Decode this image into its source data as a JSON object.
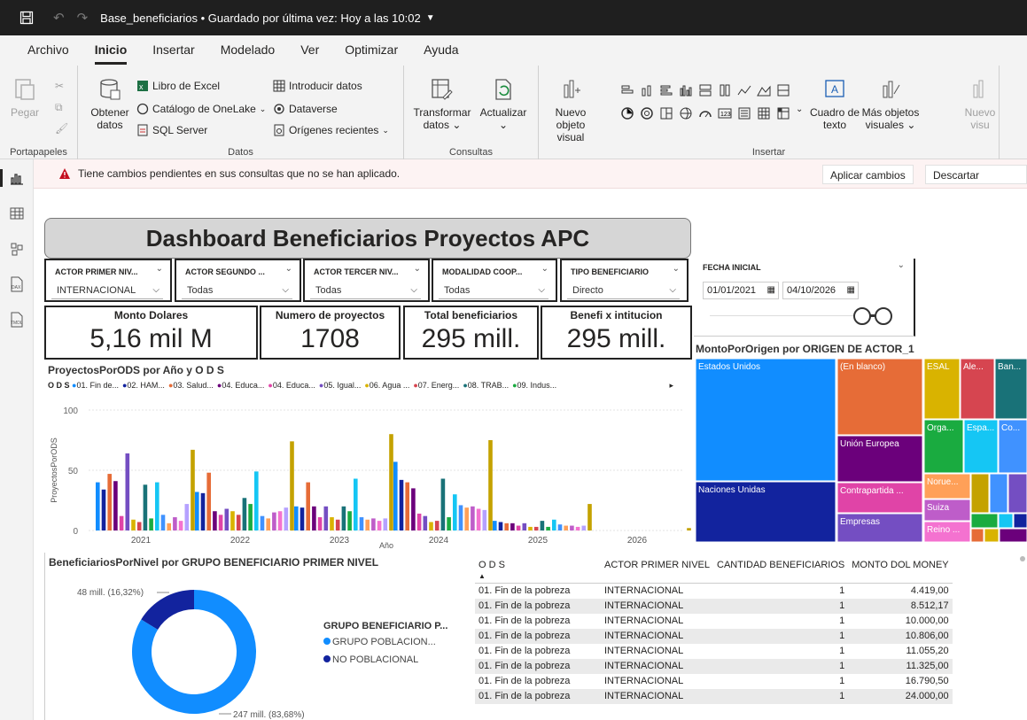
{
  "titlebar": {
    "title": "Base_beneficiarios • Guardado por última vez: Hoy a las 10:02"
  },
  "tabs": [
    "Archivo",
    "Inicio",
    "Insertar",
    "Modelado",
    "Ver",
    "Optimizar",
    "Ayuda"
  ],
  "ribbon": {
    "portapapeles": {
      "paste": "Pegar",
      "label": "Portapapeles"
    },
    "datos": {
      "get_data": "Obtener datos",
      "excel": "Libro de Excel",
      "onelake": "Catálogo de OneLake",
      "sql": "SQL Server",
      "enter_data": "Introducir datos",
      "dataverse": "Dataverse",
      "recent": "Orígenes recientes",
      "label": "Datos"
    },
    "consultas": {
      "transform": "Transformar datos",
      "refresh": "Actualizar",
      "label": "Consultas"
    },
    "insertar": {
      "new_visual": "Nuevo objeto visual",
      "text_box": "Cuadro de texto",
      "more_visuals": "Más objetos visuales",
      "new_visual_2": "Nuevo visu",
      "label": "Insertar"
    }
  },
  "warning": {
    "text": "Tiene cambios pendientes en sus consultas que no se han aplicado.",
    "apply": "Aplicar cambios",
    "discard": "Descartar cambios"
  },
  "dashboard": {
    "title": "Dashboard Beneficiarios Proyectos APC",
    "slicers": [
      {
        "header": "ACTOR PRIMER NIV...",
        "value": "INTERNACIONAL"
      },
      {
        "header": "ACTOR SEGUNDO ...",
        "value": "Todas"
      },
      {
        "header": "ACTOR TERCER NIV...",
        "value": "Todas"
      },
      {
        "header": "MODALIDAD COOP...",
        "value": "Todas"
      },
      {
        "header": "TIPO BENEFICIARIO",
        "value": "Directo"
      }
    ],
    "date_slicer": {
      "header": "FECHA INICIAL",
      "from": "01/01/2021",
      "to": "04/10/2026"
    },
    "kpis": [
      {
        "label": "Monto Dolares",
        "value": "5,16 mil M"
      },
      {
        "label": "Numero de proyectos",
        "value": "1708"
      },
      {
        "label": "Total beneficiarios",
        "value": "295 mill."
      },
      {
        "label": "Benefi x intitucion",
        "value": "295 mill."
      }
    ],
    "bar_chart_title": "ProyectosPorODS por Año y O D S",
    "treemap_title": "MontoPorOrigen por ORIGEN DE ACTOR_1",
    "donut_title": "BeneficiariosPorNivel por GRUPO BENEFICIARIO PRIMER NIVEL",
    "donut_legend_title": "GRUPO BENEFICIARIO P...",
    "donut_labels": [
      "48 mill. (16,32%)",
      "247 mill. (83,68%)"
    ],
    "table": {
      "headers": [
        "O D S",
        "ACTOR PRIMER NIVEL",
        "CANTIDAD BENEFICIARIOS",
        "MONTO DOL MONEY"
      ],
      "rows": [
        [
          "01. Fin de la pobreza",
          "INTERNACIONAL",
          "1",
          "4.419,00"
        ],
        [
          "01. Fin de la pobreza",
          "INTERNACIONAL",
          "1",
          "8.512,17"
        ],
        [
          "01. Fin de la pobreza",
          "INTERNACIONAL",
          "1",
          "10.000,00"
        ],
        [
          "01. Fin de la pobreza",
          "INTERNACIONAL",
          "1",
          "10.806,00"
        ],
        [
          "01. Fin de la pobreza",
          "INTERNACIONAL",
          "1",
          "11.055,20"
        ],
        [
          "01. Fin de la pobreza",
          "INTERNACIONAL",
          "1",
          "11.325,00"
        ],
        [
          "01. Fin de la pobreza",
          "INTERNACIONAL",
          "1",
          "16.790,50"
        ],
        [
          "01. Fin de la pobreza",
          "INTERNACIONAL",
          "1",
          "24.000,00"
        ]
      ]
    }
  },
  "chart_data": [
    {
      "type": "bar",
      "title": "ProyectosPorODS por Año y O D S",
      "xlabel": "Año",
      "ylabel": "ProyectosPorODS",
      "ylim": [
        0,
        100
      ],
      "yticks": [
        0,
        50,
        100
      ],
      "legend_title": "O D S",
      "legend_placement": "top",
      "categories": [
        "2021",
        "2022",
        "2023",
        "2024",
        "2025",
        "2026"
      ],
      "series": [
        {
          "name": "01. Fin de...",
          "color": "#118DFF",
          "values": [
            40,
            32,
            20,
            57,
            8,
            0
          ]
        },
        {
          "name": "02. HAM...",
          "color": "#12239E",
          "values": [
            34,
            31,
            19,
            42,
            7,
            0
          ]
        },
        {
          "name": "03. Salud...",
          "color": "#E66C37",
          "values": [
            47,
            48,
            40,
            40,
            6,
            0
          ]
        },
        {
          "name": "04. Educa...",
          "color": "#6B007B",
          "values": [
            41,
            16,
            20,
            35,
            6,
            0
          ]
        },
        {
          "name": "04. Educa...",
          "color": "#E044A7",
          "values": [
            12,
            13,
            11,
            14,
            4,
            0
          ]
        },
        {
          "name": "05. Igual...",
          "color": "#744EC2",
          "values": [
            64,
            18,
            20,
            12,
            6,
            0
          ]
        },
        {
          "name": "06. Agua ...",
          "color": "#D9B300",
          "values": [
            9,
            16,
            11,
            7,
            3,
            0
          ]
        },
        {
          "name": "07. Energ...",
          "color": "#D64550",
          "values": [
            7,
            13,
            9,
            8,
            3,
            0
          ]
        },
        {
          "name": "08. TRAB...",
          "color": "#197278",
          "values": [
            38,
            27,
            20,
            43,
            8,
            0
          ]
        },
        {
          "name": "09. Indus...",
          "color": "#1AAB40",
          "values": [
            10,
            22,
            16,
            11,
            3,
            0
          ]
        },
        {
          "name": "",
          "color": "#15C6F4",
          "values": [
            40,
            49,
            43,
            30,
            9,
            0
          ]
        },
        {
          "name": "",
          "color": "#4092FF",
          "values": [
            13,
            12,
            11,
            21,
            5,
            0
          ]
        },
        {
          "name": "",
          "color": "#FFA058",
          "values": [
            6,
            10,
            9,
            19,
            4,
            0
          ]
        },
        {
          "name": "",
          "color": "#BE5DC9",
          "values": [
            11,
            15,
            10,
            20,
            4,
            0
          ]
        },
        {
          "name": "",
          "color": "#F472D0",
          "values": [
            8,
            16,
            8,
            18,
            3,
            0
          ]
        },
        {
          "name": "",
          "color": "#B5A1FF",
          "values": [
            22,
            19,
            10,
            17,
            4,
            0
          ]
        },
        {
          "name": "",
          "color": "#C4A200",
          "values": [
            67,
            74,
            80,
            75,
            22,
            2
          ]
        }
      ]
    },
    {
      "type": "treemap",
      "title": "MontoPorOrigen por ORIGEN DE ACTOR_1",
      "categories": [
        "Estados Unidos",
        "Naciones Unidas",
        "(En blanco)",
        "Unión Europea",
        "Contrapartida ...",
        "Empresas",
        "ESAL",
        "Ale...",
        "Ban...",
        "Orga...",
        "Espa...",
        "Co...",
        "Norue...",
        "Suiza",
        "Reino ..."
      ],
      "colors": [
        "#118DFF",
        "#12239E",
        "#E66C37",
        "#6B007B",
        "#E044A7",
        "#744EC2",
        "#D9B300",
        "#D64550",
        "#197278",
        "#1AAB40",
        "#15C6F4",
        "#4092FF",
        "#FFA058",
        "#BE5DC9",
        "#F472D0"
      ]
    },
    {
      "type": "pie",
      "title": "BeneficiariosPorNivel por GRUPO BENEFICIARIO PRIMER NIVEL",
      "categories": [
        "GRUPO POBLACION...",
        "NO POBLACIONAL"
      ],
      "values": [
        247,
        48
      ],
      "percents": [
        83.68,
        16.32
      ],
      "colors": [
        "#118DFF",
        "#12239E"
      ],
      "legend_placement": "right"
    }
  ]
}
